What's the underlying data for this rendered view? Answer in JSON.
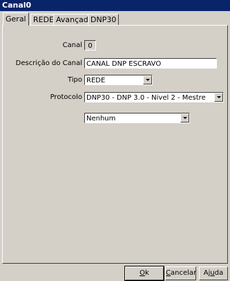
{
  "window": {
    "title": "Canal0"
  },
  "tabs": [
    {
      "label": "Geral"
    },
    {
      "label": "REDE"
    },
    {
      "label": "Avançado"
    },
    {
      "label": "DNP30"
    }
  ],
  "form": {
    "canal": {
      "label": "Canal",
      "value": "0"
    },
    "descricao": {
      "label": "Descrição do Canal",
      "value": "CANAL DNP ESCRAVO"
    },
    "tipo": {
      "label": "Tipo",
      "value": "REDE"
    },
    "protocolo": {
      "label": "Protocolo",
      "value": "DNP30 - DNP 3.0 - Nivel 2 - Mestre"
    },
    "extra": {
      "value": "Nenhum"
    }
  },
  "buttons": {
    "ok": {
      "hotkey": "O",
      "rest": "k"
    },
    "cancelar": {
      "hotkey": "C",
      "rest": "ancelar"
    },
    "ajuda": {
      "pre": "Aj",
      "hotkey": "u",
      "rest": "da"
    }
  },
  "colors": {
    "titlebar": "#0a246a",
    "face": "#d4d0c8"
  }
}
